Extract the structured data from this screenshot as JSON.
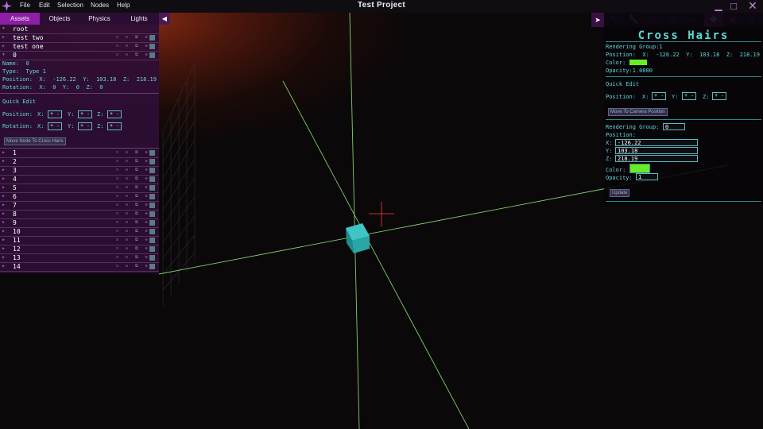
{
  "app": {
    "title": "Test Project"
  },
  "menu": [
    "File",
    "Edit",
    "Selection",
    "Nodes",
    "Help"
  ],
  "left_panel": {
    "tabs": [
      "Assets",
      "Objects",
      "Physics",
      "Lights"
    ],
    "active_tab": "Assets",
    "collapse_icon": "chevron-left-icon",
    "tree": [
      {
        "label": "root"
      },
      {
        "label": "test two"
      },
      {
        "label": "test one"
      },
      {
        "label": "0"
      }
    ],
    "row_icons": "x ⊙ ⧉ ⊕",
    "details": {
      "name_label": "Name:",
      "name_value": "0",
      "type_label": "Type:",
      "type_value": "Type 1",
      "position_label": "Position:",
      "px_label": "X:",
      "px": "-126.22",
      "py_label": "Y:",
      "py": "103.18",
      "pz_label": "Z:",
      "pz": "218.19",
      "rotation_label": "Rotation:",
      "rx_label": "X:",
      "rx": "0",
      "ry_label": "Y:",
      "ry": "0",
      "rz_label": "Z:",
      "rz": "0"
    },
    "quick_edit": {
      "title": "Quick Edit",
      "position_label": "Position:",
      "rotation_label": "Rotation:",
      "x": "X:",
      "y": "Y:",
      "z": "Z:",
      "plus": "+",
      "minus": "-",
      "move_button": "Move Node To Cross Hairs"
    },
    "numbered_items": [
      "1",
      "2",
      "3",
      "4",
      "5",
      "6",
      "7",
      "8",
      "9",
      "10",
      "11",
      "12",
      "13",
      "14"
    ]
  },
  "right_panel": {
    "tools": [
      "script-icon",
      "wrench-icon",
      "file-icon",
      "trash-icon",
      "frame-icon",
      "move-icon",
      "image-icon",
      "gear-icon"
    ],
    "active_tool": "move-icon",
    "expand_icon": "chevron-right-icon",
    "title": "Cross Hairs",
    "info": {
      "rendering_group": "Rendering Group:1",
      "position_label": "Position:",
      "x_label": "X:",
      "x": "-126.22",
      "y_label": "Y:",
      "y": "103.18",
      "z_label": "Z:",
      "z": "218.19",
      "color_label": "Color:",
      "opacity": "Opacity:1.0000"
    },
    "quick_edit": {
      "title": "Quick Edit",
      "position_label": "Position:",
      "x": "X:",
      "y": "Y:",
      "z": "Z:",
      "plus": "+",
      "minus": "-",
      "move_button": "Move To Camera Position"
    },
    "form": {
      "rendering_group_label": "Rendering Group:",
      "rendering_group_value": "0",
      "position_label": "Position:",
      "x_label": "X:",
      "x_value": "-126.22",
      "y_label": "Y:",
      "y_value": "103.18",
      "z_label": "Z:",
      "z_value": "218.19",
      "color_label": "Color:",
      "opacity_label": "Opacity:",
      "opacity_value": "1",
      "update_button": "Update"
    }
  },
  "colors": {
    "accent": "#8e1ea6",
    "cyan_text": "#5fd8d8",
    "crosshair_color": "#66ee22",
    "axis_green": "#7fcf6a",
    "cube": "#2aa6a6",
    "crosshair": "#cc2a2a"
  }
}
